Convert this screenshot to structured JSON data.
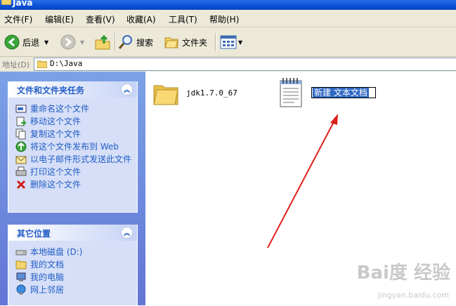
{
  "window": {
    "title": "Java"
  },
  "menu": [
    "文件(F)",
    "编辑(E)",
    "查看(V)",
    "收藏(A)",
    "工具(T)",
    "帮助(H)"
  ],
  "toolbar": {
    "back": "后退",
    "search": "搜索",
    "folders": "文件夹"
  },
  "address": {
    "label": "地址(D)",
    "value": "D:\\Java"
  },
  "file_tasks": {
    "title": "文件和文件夹任务",
    "items": [
      {
        "label": "重命名这个文件",
        "icon": "rename-icon"
      },
      {
        "label": "移动这个文件",
        "icon": "move-icon"
      },
      {
        "label": "复制这个文件",
        "icon": "copy-icon"
      },
      {
        "label": "将这个文件发布到 Web",
        "icon": "publish-web-icon"
      },
      {
        "label": "以电子邮件形式发送此文件",
        "icon": "email-icon"
      },
      {
        "label": "打印这个文件",
        "icon": "print-icon"
      },
      {
        "label": "删除这个文件",
        "icon": "delete-icon"
      }
    ]
  },
  "other_places": {
    "title": "其它位置",
    "items": [
      {
        "label": "本地磁盘 (D:)",
        "icon": "drive-icon"
      },
      {
        "label": "我的文档",
        "icon": "my-documents-icon"
      },
      {
        "label": "我的电脑",
        "icon": "my-computer-icon"
      },
      {
        "label": "网上邻居",
        "icon": "network-icon"
      }
    ]
  },
  "files": [
    {
      "name": "jdk1.7.0_67",
      "icon": "folder-icon"
    },
    {
      "name": "新建 文本文档",
      "icon": "text-document-icon",
      "renaming": true
    }
  ],
  "watermark": {
    "main": "Bai度 经验",
    "sub": "jingyan.baidu.com"
  },
  "colors": {
    "task_text": "#215dc6",
    "selection": "#316ac5",
    "arrow": "#e0201c"
  }
}
